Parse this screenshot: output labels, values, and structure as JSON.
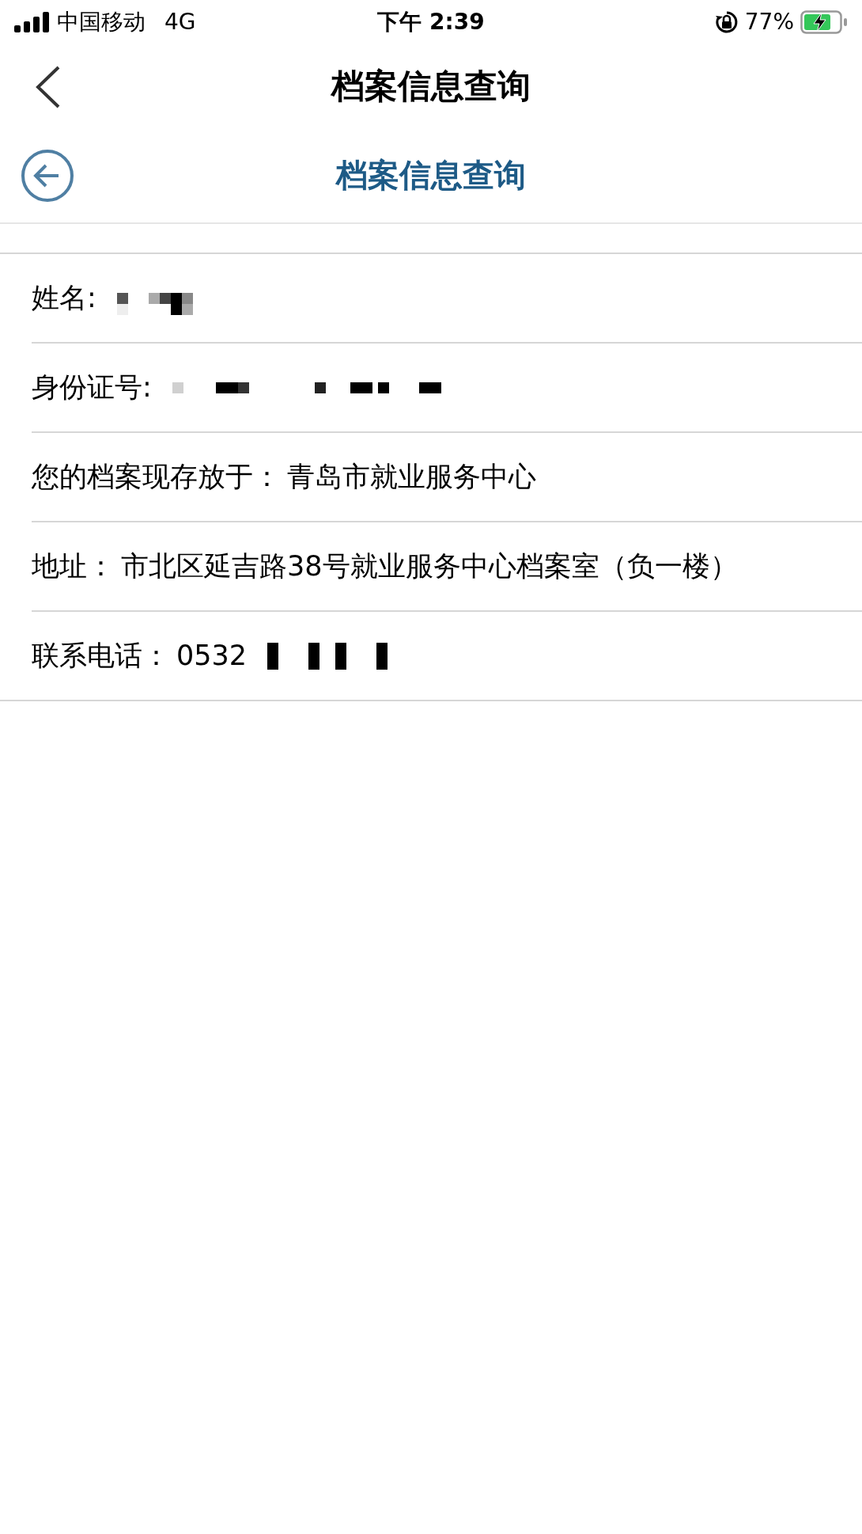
{
  "status_bar": {
    "carrier": "中国移动",
    "network": "4G",
    "time": "下午 2:39",
    "battery_percent": "77%",
    "charging": true
  },
  "nav_bar": {
    "title": "档案信息查询"
  },
  "page_header": {
    "title": "档案信息查询"
  },
  "rows": [
    {
      "label": "姓名:",
      "redacted": true
    },
    {
      "label": "身份证号:",
      "redacted": true
    },
    {
      "label": "您的档案现存放于：",
      "value": "青岛市就业服务中心"
    },
    {
      "label": "地址：",
      "value": "市北区延吉路38号就业服务中心档案室（负一楼）"
    },
    {
      "label": "联系电话：",
      "value": "0532",
      "redacted": true
    }
  ]
}
